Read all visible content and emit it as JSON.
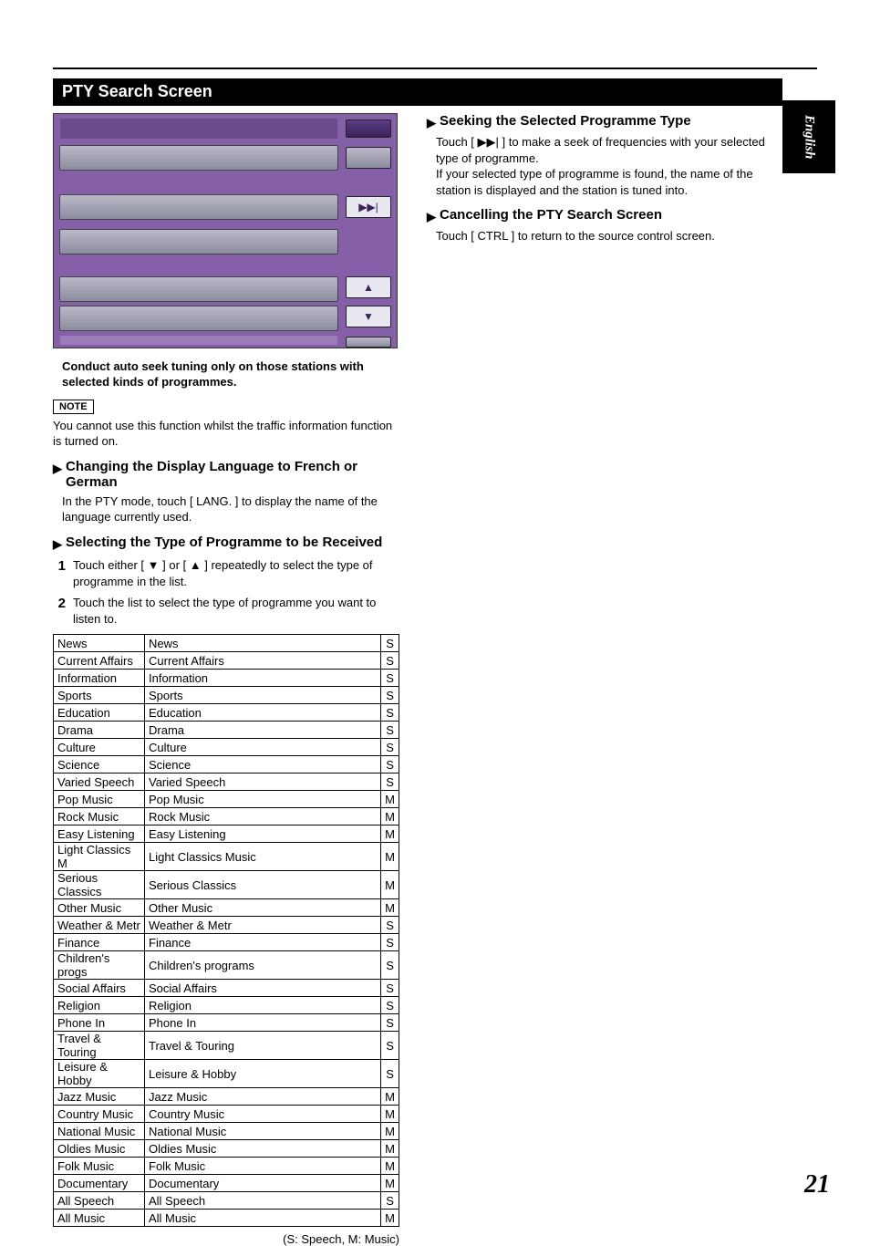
{
  "language_tab": "English",
  "page_number": "21",
  "section_title": "PTY Search Screen",
  "lead_text": "Conduct auto seek tuning only on those stations with selected kinds of programmes.",
  "note_label": "NOTE",
  "note_text": "You cannot use this function whilst the traffic information function is turned on.",
  "heading_lang": "Changing the Display Language to French or German",
  "text_lang": "In the PTY mode, touch [ LANG. ] to display the name of the language currently used.",
  "heading_select": "Selecting the Type of Programme to be Received",
  "step1": "Touch either [ ▼ ] or [ ▲ ] repeatedly to select the type of programme in the list.",
  "step2": "Touch the list to select the type of programme you want to listen to.",
  "heading_seek": "Seeking the Selected Programme Type",
  "text_seek": "Touch [ ▶▶| ] to make a seek of frequencies with your selected type of programme.\nIf your selected type of programme is found, the name of the station is displayed and the station is tuned into.",
  "heading_cancel": "Cancelling the PTY Search Screen",
  "text_cancel": "Touch [ CTRL ] to return to the source control screen.",
  "legend": "(S: Speech, M: Music)",
  "pty_table": [
    {
      "c1": "News",
      "c2": "News",
      "c3": "S"
    },
    {
      "c1": "Current Affairs",
      "c2": "Current Affairs",
      "c3": "S"
    },
    {
      "c1": "Information",
      "c2": "Information",
      "c3": "S"
    },
    {
      "c1": "Sports",
      "c2": "Sports",
      "c3": "S"
    },
    {
      "c1": "Education",
      "c2": "Education",
      "c3": "S"
    },
    {
      "c1": "Drama",
      "c2": "Drama",
      "c3": "S"
    },
    {
      "c1": "Culture",
      "c2": "Culture",
      "c3": "S"
    },
    {
      "c1": "Science",
      "c2": "Science",
      "c3": "S"
    },
    {
      "c1": "Varied Speech",
      "c2": "Varied Speech",
      "c3": "S"
    },
    {
      "c1": "Pop Music",
      "c2": "Pop Music",
      "c3": "M"
    },
    {
      "c1": "Rock Music",
      "c2": "Rock Music",
      "c3": "M"
    },
    {
      "c1": "Easy Listening",
      "c2": "Easy Listening",
      "c3": "M"
    },
    {
      "c1": "Light Classics M",
      "c2": "Light Classics Music",
      "c3": "M"
    },
    {
      "c1": "Serious Classics",
      "c2": "Serious Classics",
      "c3": "M"
    },
    {
      "c1": "Other Music",
      "c2": "Other Music",
      "c3": "M"
    },
    {
      "c1": "Weather & Metr",
      "c2": "Weather & Metr",
      "c3": "S"
    },
    {
      "c1": "Finance",
      "c2": "Finance",
      "c3": "S"
    },
    {
      "c1": "Children's progs",
      "c2": "Children's programs",
      "c3": "S"
    },
    {
      "c1": "Social Affairs",
      "c2": "Social Affairs",
      "c3": "S"
    },
    {
      "c1": "Religion",
      "c2": "Religion",
      "c3": "S"
    },
    {
      "c1": "Phone In",
      "c2": "Phone In",
      "c3": "S"
    },
    {
      "c1": "Travel & Touring",
      "c2": "Travel & Touring",
      "c3": "S"
    },
    {
      "c1": "Leisure & Hobby",
      "c2": "Leisure & Hobby",
      "c3": "S"
    },
    {
      "c1": "Jazz Music",
      "c2": "Jazz Music",
      "c3": "M"
    },
    {
      "c1": "Country Music",
      "c2": "Country Music",
      "c3": "M"
    },
    {
      "c1": "National Music",
      "c2": "National Music",
      "c3": "M"
    },
    {
      "c1": "Oldies Music",
      "c2": "Oldies Music",
      "c3": "M"
    },
    {
      "c1": "Folk Music",
      "c2": "Folk Music",
      "c3": "M"
    },
    {
      "c1": "Documentary",
      "c2": "Documentary",
      "c3": "M"
    },
    {
      "c1": "All Speech",
      "c2": "All Speech",
      "c3": "S"
    },
    {
      "c1": "All Music",
      "c2": "All Music",
      "c3": "M"
    }
  ]
}
